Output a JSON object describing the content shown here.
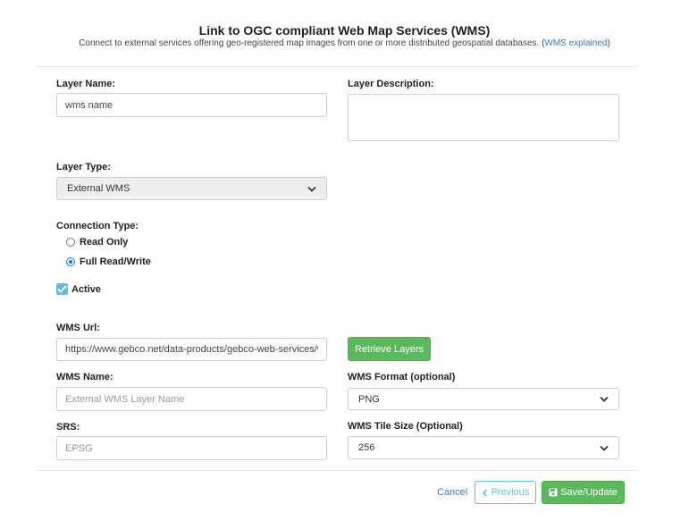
{
  "header": {
    "title": "Link to OGC compliant Web Map Services (WMS)",
    "subtitle": "Connect to external services offering geo-registered map images from one or more distributed geospatial databases. (",
    "subtitle_link": "WMS explained",
    "subtitle_close": ")"
  },
  "form": {
    "layer_name": {
      "label": "Layer Name:",
      "value": "wms name"
    },
    "layer_description": {
      "label": "Layer Description:",
      "value": ""
    },
    "layer_type": {
      "label": "Layer Type:",
      "value": "External WMS"
    },
    "connection_type": {
      "label": "Connection Type:",
      "options": [
        {
          "label": "Read Only",
          "checked": false
        },
        {
          "label": "Full Read/Write",
          "checked": true
        }
      ]
    },
    "active": {
      "label": "Active",
      "checked": true
    },
    "wms_url": {
      "label": "WMS Url:",
      "value": "https://www.gebco.net/data-products/gebco-web-services/web-map-service"
    },
    "retrieve_layers": "Retrieve Layers",
    "wms_name": {
      "label": "WMS Name:",
      "placeholder": "External WMS Layer Name"
    },
    "wms_format": {
      "label": "WMS Format (optional)",
      "value": "PNG"
    },
    "srs": {
      "label": "SRS:",
      "placeholder": "EPSG"
    },
    "wms_tile_size": {
      "label": "WMS Tile Size (Optional)",
      "value": "256"
    }
  },
  "footer": {
    "cancel": "Cancel",
    "previous": "Previous",
    "save": "Save/Update"
  },
  "colors": {
    "primary_green": "#5cb85c",
    "info_blue": "#5bc0de",
    "link_blue": "#337ab7",
    "radio_blue": "#0075ff"
  },
  "icons": {
    "previous": "chevron-left-icon",
    "save": "floppy-disk-icon",
    "select": "chevron-down-icon",
    "check": "checkmark-icon"
  }
}
